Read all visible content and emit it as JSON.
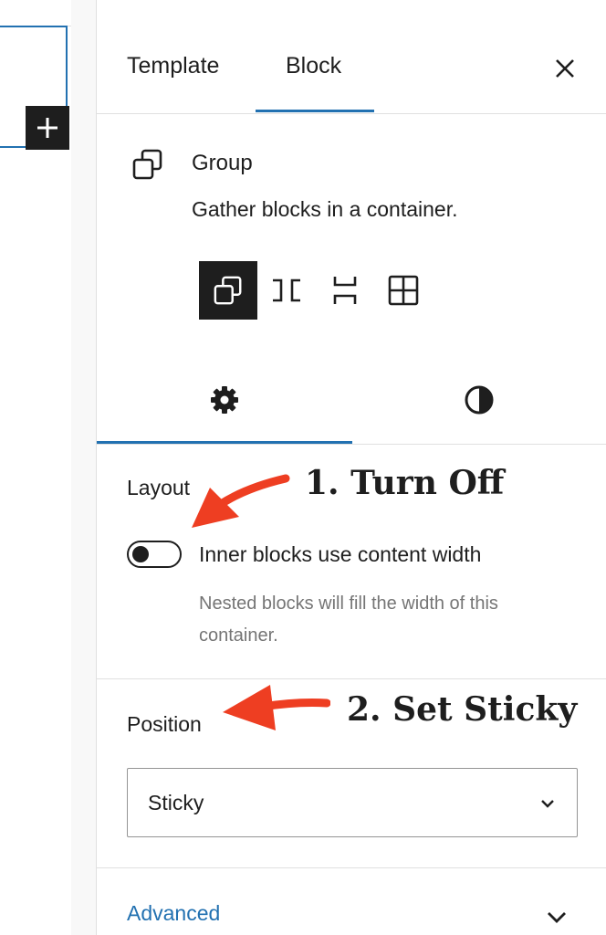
{
  "sidebar": {
    "tabs": [
      {
        "label": "Template"
      },
      {
        "label": "Block"
      }
    ],
    "active_tab": "Block",
    "block_card": {
      "title": "Group",
      "description": "Gather blocks in a container.",
      "icon": "group-icon",
      "variations": [
        {
          "icon": "group-icon",
          "active": true
        },
        {
          "icon": "row-icon",
          "active": false
        },
        {
          "icon": "stack-icon",
          "active": false
        },
        {
          "icon": "grid-icon",
          "active": false
        }
      ]
    },
    "settings_tabs": [
      {
        "icon": "gear-icon",
        "active": true
      },
      {
        "icon": "styles-icon",
        "active": false
      }
    ],
    "layout": {
      "title": "Layout",
      "toggle_label": "Inner blocks use content width",
      "toggle_on": false,
      "toggle_help": "Nested blocks will fill the width of this container."
    },
    "position": {
      "title": "Position",
      "selected": "Sticky"
    },
    "advanced": {
      "title": "Advanced"
    }
  },
  "annotations": {
    "step1": "1. Turn Off",
    "step2": "2. Set Sticky",
    "arrow_color": "#ee3e22"
  },
  "colors": {
    "accent": "#2271b1",
    "dark": "#1e1e1e",
    "help_text": "#757575"
  }
}
